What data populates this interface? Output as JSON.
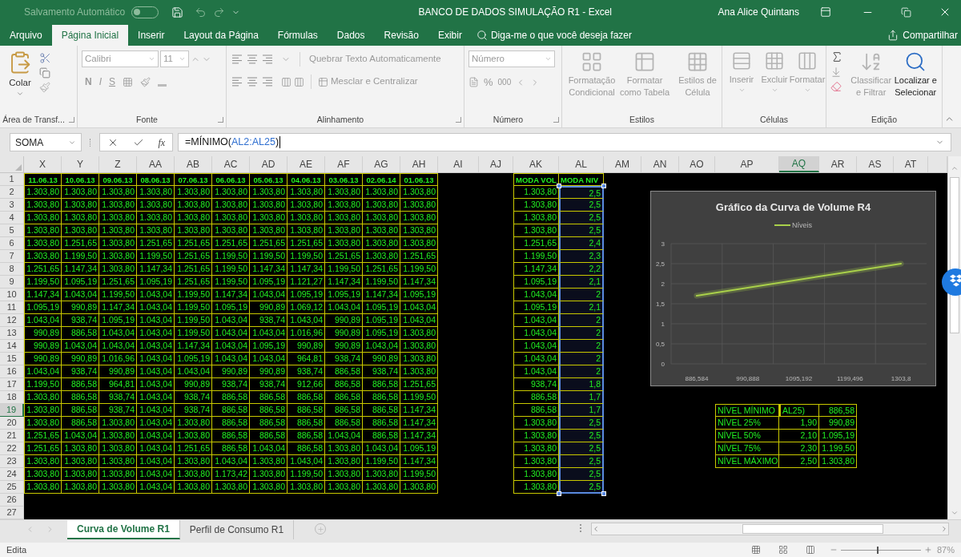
{
  "title_bar": {
    "autosave_label": "Salvamento Automático",
    "autosave_on": false,
    "document_title": "BANCO DE DADOS SIMULAÇÃO R1  -  Excel",
    "user": "Ana Alice Quintans"
  },
  "menu_tabs": [
    {
      "label": "Arquivo",
      "selected": false
    },
    {
      "label": "Página Inicial",
      "selected": true
    },
    {
      "label": "Inserir",
      "selected": false
    },
    {
      "label": "Layout da Página",
      "selected": false
    },
    {
      "label": "Fórmulas",
      "selected": false
    },
    {
      "label": "Dados",
      "selected": false
    },
    {
      "label": "Revisão",
      "selected": false
    },
    {
      "label": "Exibir",
      "selected": false
    }
  ],
  "tell_me": {
    "placeholder": "Diga-me o que você deseja fazer"
  },
  "share": "Compartilhar",
  "ribbon": {
    "clipboard": {
      "paste": "Colar",
      "group": "Área de Transf..."
    },
    "font": {
      "family": "Calibri",
      "size": "11",
      "bold": "N",
      "italic": "I",
      "underline": "S",
      "group": "Fonte"
    },
    "alignment": {
      "wrap": "Quebrar Texto Automaticamente",
      "merge": "Mesclar e Centralizar",
      "group": "Alinhamento"
    },
    "number": {
      "format": "Número",
      "percent": "%",
      "thousands": "000",
      "group": "Número"
    },
    "styles": {
      "items": [
        "Formatação Condicional",
        "Formatar como Tabela",
        "Estilos de Célula"
      ],
      "group": "Estilos"
    },
    "cells": {
      "items": [
        "Inserir",
        "Excluir",
        "Formatar"
      ],
      "group": "Células"
    },
    "editing": {
      "items": [
        {
          "label": "Classificar e Filtrar",
          "disabled": true
        },
        {
          "label": "Localizar e Selecionar",
          "disabled": false
        }
      ],
      "group": "Edição"
    }
  },
  "formula_bar": {
    "name_box": "SOMA",
    "function_label": "fx",
    "formula": [
      {
        "text": "=MÍNIMO(",
        "kind": "plain"
      },
      {
        "text": "AL2:AL25",
        "kind": "reference"
      },
      {
        "text": ")",
        "kind": "plain"
      }
    ]
  },
  "grid": {
    "columns": [
      {
        "label": "X",
        "selected": false
      },
      {
        "label": "Y",
        "selected": false
      },
      {
        "label": "Z",
        "selected": false
      },
      {
        "label": "AA",
        "selected": false
      },
      {
        "label": "AB",
        "selected": false
      },
      {
        "label": "AC",
        "selected": false
      },
      {
        "label": "AD",
        "selected": false
      },
      {
        "label": "AE",
        "selected": false
      },
      {
        "label": "AF",
        "selected": false
      },
      {
        "label": "AG",
        "selected": false
      },
      {
        "label": "AH",
        "selected": false
      },
      {
        "label": "AI",
        "selected": false
      },
      {
        "label": "AJ",
        "selected": false
      },
      {
        "label": "AK",
        "selected": false
      },
      {
        "label": "AL",
        "selected": false
      },
      {
        "label": "AM",
        "selected": false
      },
      {
        "label": "AN",
        "selected": false
      },
      {
        "label": "AO",
        "selected": false
      },
      {
        "label": "AP",
        "selected": false
      },
      {
        "label": "AQ",
        "selected": true
      },
      {
        "label": "AR",
        "selected": false
      },
      {
        "label": "AS",
        "selected": false
      },
      {
        "label": "AT",
        "selected": false
      }
    ],
    "rows": [
      {
        "number": "1",
        "selected": false,
        "header": true,
        "in_reference": false,
        "cells": [
          "11.06.13",
          "10.06.13",
          "09.06.13",
          "08.06.13",
          "07.06.13",
          "06.06.13",
          "05.06.13",
          "04.06.13",
          "03.06.13",
          "02.06.14",
          "01.06.13"
        ],
        "ak": "MODA VOL",
        "al": "MODA NIV"
      },
      {
        "number": "2",
        "selected": false,
        "header": false,
        "in_reference": true,
        "cells": [
          "1.303,80",
          "1.303,80",
          "1.303,80",
          "1.303,80",
          "1.303,80",
          "1.303,80",
          "1.303,80",
          "1.303,80",
          "1.303,80",
          "1.303,80",
          "1.303,80"
        ],
        "ak": "1.303,80",
        "al": "2,5"
      },
      {
        "number": "3",
        "selected": false,
        "header": false,
        "in_reference": true,
        "cells": [
          "1.303,80",
          "1.303,80",
          "1.303,80",
          "1.303,80",
          "1.303,80",
          "1.303,80",
          "1.303,80",
          "1.303,80",
          "1.303,80",
          "1.303,80",
          "1.303,80"
        ],
        "ak": "1.303,80",
        "al": "2,5"
      },
      {
        "number": "4",
        "selected": false,
        "header": false,
        "in_reference": true,
        "cells": [
          "1.303,80",
          "1.303,80",
          "1.303,80",
          "1.303,80",
          "1.303,80",
          "1.303,80",
          "1.303,80",
          "1.303,80",
          "1.303,80",
          "1.303,80",
          "1.303,80"
        ],
        "ak": "1.303,80",
        "al": "2,5"
      },
      {
        "number": "5",
        "selected": false,
        "header": false,
        "in_reference": true,
        "cells": [
          "1.303,80",
          "1.303,80",
          "1.303,80",
          "1.303,80",
          "1.303,80",
          "1.303,80",
          "1.303,80",
          "1.303,80",
          "1.303,80",
          "1.303,80",
          "1.303,80"
        ],
        "ak": "1.303,80",
        "al": "2,5"
      },
      {
        "number": "6",
        "selected": false,
        "header": false,
        "in_reference": true,
        "cells": [
          "1.303,80",
          "1.251,65",
          "1.303,80",
          "1.251,65",
          "1.251,65",
          "1.251,65",
          "1.251,65",
          "1.251,65",
          "1.303,80",
          "1.303,80",
          "1.303,80"
        ],
        "ak": "1.251,65",
        "al": "2,4"
      },
      {
        "number": "7",
        "selected": false,
        "header": false,
        "in_reference": true,
        "cells": [
          "1.303,80",
          "1.199,50",
          "1.303,80",
          "1.199,50",
          "1.251,65",
          "1.199,50",
          "1.199,50",
          "1.199,50",
          "1.251,65",
          "1.303,80",
          "1.251,65"
        ],
        "ak": "1.199,50",
        "al": "2,3"
      },
      {
        "number": "8",
        "selected": false,
        "header": false,
        "in_reference": true,
        "cells": [
          "1.251,65",
          "1.147,34",
          "1.303,80",
          "1.147,34",
          "1.251,65",
          "1.199,50",
          "1.147,34",
          "1.147,34",
          "1.199,50",
          "1.251,65",
          "1.199,50"
        ],
        "ak": "1.147,34",
        "al": "2,2"
      },
      {
        "number": "9",
        "selected": false,
        "header": false,
        "in_reference": true,
        "cells": [
          "1.199,50",
          "1.095,19",
          "1.251,65",
          "1.095,19",
          "1.251,65",
          "1.199,50",
          "1.095,19",
          "1.121,27",
          "1.147,34",
          "1.199,50",
          "1.147,34"
        ],
        "ak": "1.095,19",
        "al": "2,1"
      },
      {
        "number": "10",
        "selected": false,
        "header": false,
        "in_reference": true,
        "cells": [
          "1.147,34",
          "1.043,04",
          "1.199,50",
          "1.043,04",
          "1.199,50",
          "1.147,34",
          "1.043,04",
          "1.095,19",
          "1.095,19",
          "1.147,34",
          "1.095,19"
        ],
        "ak": "1.043,04",
        "al": "2"
      },
      {
        "number": "11",
        "selected": false,
        "header": false,
        "in_reference": true,
        "cells": [
          "1.095,19",
          "990,89",
          "1.147,34",
          "1.043,04",
          "1.199,50",
          "1.095,19",
          "990,89",
          "1.069,12",
          "1.043,04",
          "1.095,19",
          "1.043,04"
        ],
        "ak": "1.095,19",
        "al": "2,1"
      },
      {
        "number": "12",
        "selected": false,
        "header": false,
        "in_reference": true,
        "cells": [
          "1.043,04",
          "938,74",
          "1.095,19",
          "1.043,04",
          "1.199,50",
          "1.043,04",
          "938,74",
          "1.043,04",
          "990,89",
          "1.095,19",
          "1.043,04"
        ],
        "ak": "1.043,04",
        "al": "2"
      },
      {
        "number": "13",
        "selected": false,
        "header": false,
        "in_reference": true,
        "cells": [
          "990,89",
          "886,58",
          "1.043,04",
          "1.043,04",
          "1.199,50",
          "1.043,04",
          "1.043,04",
          "1.016,96",
          "990,89",
          "1.095,19",
          "1.303,80"
        ],
        "ak": "1.043,04",
        "al": "2"
      },
      {
        "number": "14",
        "selected": false,
        "header": false,
        "in_reference": true,
        "cells": [
          "990,89",
          "1.043,04",
          "1.043,04",
          "1.043,04",
          "1.147,34",
          "1.043,04",
          "1.095,19",
          "990,89",
          "990,89",
          "1.043,04",
          "1.303,80"
        ],
        "ak": "1.043,04",
        "al": "2"
      },
      {
        "number": "15",
        "selected": false,
        "header": false,
        "in_reference": true,
        "cells": [
          "990,89",
          "990,89",
          "1.016,96",
          "1.043,04",
          "1.095,19",
          "1.043,04",
          "1.043,04",
          "964,81",
          "938,74",
          "990,89",
          "1.303,80"
        ],
        "ak": "1.043,04",
        "al": "2"
      },
      {
        "number": "16",
        "selected": false,
        "header": false,
        "in_reference": true,
        "cells": [
          "1.043,04",
          "938,74",
          "990,89",
          "1.043,04",
          "1.043,04",
          "990,89",
          "990,89",
          "938,74",
          "886,58",
          "938,74",
          "1.303,80"
        ],
        "ak": "1.043,04",
        "al": "2"
      },
      {
        "number": "17",
        "selected": false,
        "header": false,
        "in_reference": true,
        "cells": [
          "1.199,50",
          "886,58",
          "964,81",
          "1.043,04",
          "990,89",
          "938,74",
          "938,74",
          "912,66",
          "886,58",
          "886,58",
          "1.251,65"
        ],
        "ak": "938,74",
        "al": "1,8"
      },
      {
        "number": "18",
        "selected": false,
        "header": false,
        "in_reference": true,
        "cells": [
          "1.303,80",
          "886,58",
          "938,74",
          "1.043,04",
          "938,74",
          "886,58",
          "886,58",
          "886,58",
          "886,58",
          "886,58",
          "1.199,50"
        ],
        "ak": "886,58",
        "al": "1,7"
      },
      {
        "number": "19",
        "selected": true,
        "header": false,
        "in_reference": true,
        "cells": [
          "1.303,80",
          "886,58",
          "938,74",
          "1.043,04",
          "938,74",
          "886,58",
          "886,58",
          "886,58",
          "886,58",
          "886,58",
          "1.147,34"
        ],
        "ak": "886,58",
        "al": "1,7",
        "summary": {
          "label": "NÍVEL MÍNIMO",
          "value": "AL25)",
          "result": "886,58",
          "editing": true
        }
      },
      {
        "number": "20",
        "selected": false,
        "header": false,
        "in_reference": true,
        "cells": [
          "1.303,80",
          "886,58",
          "1.303,80",
          "1.043,04",
          "1.303,80",
          "886,58",
          "886,58",
          "886,58",
          "886,58",
          "886,58",
          "1.147,34"
        ],
        "ak": "1.303,80",
        "al": "2,5",
        "summary": {
          "label": "NÍVEL 25%",
          "value": "1,90",
          "result": "990,89",
          "editing": false
        }
      },
      {
        "number": "21",
        "selected": false,
        "header": false,
        "in_reference": true,
        "cells": [
          "1.251,65",
          "1.043,04",
          "1.303,80",
          "1.043,04",
          "1.303,80",
          "886,58",
          "886,58",
          "886,58",
          "1.043,04",
          "886,58",
          "1.147,34"
        ],
        "ak": "1.303,80",
        "al": "2,5",
        "summary": {
          "label": "NÍVEL 50%",
          "value": "2,10",
          "result": "1.095,19",
          "editing": false
        }
      },
      {
        "number": "22",
        "selected": false,
        "header": false,
        "in_reference": true,
        "cells": [
          "1.251,65",
          "1.303,80",
          "1.303,80",
          "1.043,04",
          "1.251,65",
          "886,58",
          "1.043,04",
          "886,58",
          "1.303,80",
          "1.043,04",
          "1.095,19"
        ],
        "ak": "1.303,80",
        "al": "2,5",
        "summary": {
          "label": "NÍVEL 75%",
          "value": "2,30",
          "result": "1.199,50",
          "editing": false
        }
      },
      {
        "number": "23",
        "selected": false,
        "header": false,
        "in_reference": true,
        "cells": [
          "1.303,80",
          "1.303,80",
          "1.303,80",
          "1.043,04",
          "1.303,80",
          "1.043,04",
          "1.303,80",
          "1.043,04",
          "1.303,80",
          "1.199,50",
          "1.147,34"
        ],
        "ak": "1.303,80",
        "al": "2,5",
        "summary": {
          "label": "NÍVEL MÁXIMO",
          "value": "2,50",
          "result": "1.303,80",
          "editing": false
        }
      },
      {
        "number": "24",
        "selected": false,
        "header": false,
        "in_reference": true,
        "cells": [
          "1.303,80",
          "1.303,80",
          "1.303,80",
          "1.043,04",
          "1.303,80",
          "1.173,42",
          "1.303,80",
          "1.199,50",
          "1.303,80",
          "1.303,80",
          "1.199,50"
        ],
        "ak": "1.303,80",
        "al": "2,5"
      },
      {
        "number": "25",
        "selected": false,
        "header": false,
        "in_reference": true,
        "cells": [
          "1.303,80",
          "1.303,80",
          "1.303,80",
          "1.043,04",
          "1.303,80",
          "1.303,80",
          "1.303,80",
          "1.303,80",
          "1.303,80",
          "1.303,80",
          "1.303,80"
        ],
        "ak": "1.303,80",
        "al": "2,5"
      },
      {
        "number": "26",
        "selected": false
      },
      {
        "number": "27",
        "selected": false
      }
    ],
    "chart": {
      "chart_data": {
        "type": "line",
        "grid": true,
        "title": "Gráfico da Curva de Volume R4",
        "categories": [
          "886,584",
          "990,888",
          "1095,192",
          "1199,496",
          "1303,8"
        ],
        "series": [
          {
            "name": "Níveis",
            "color": "#a9d04a",
            "values": [
              1.7,
              1.9,
              2.1,
              2.3,
              2.5
            ]
          }
        ],
        "ylim": [
          0,
          3
        ],
        "yticks": [
          0,
          {
            "value": 0.5,
            "label": "0,5"
          },
          1,
          {
            "value": 1.5,
            "label": "1,5"
          },
          2,
          {
            "value": 2.5,
            "label": "2,5"
          },
          3
        ]
      }
    }
  },
  "sheet_tabs": [
    {
      "label": "Curva de Volume R1",
      "selected": true
    },
    {
      "label": "Perfil de Consumo R1",
      "selected": false
    }
  ],
  "status_bar": {
    "mode": "Edita",
    "zoom": "87%",
    "zoom_slider": {
      "level": 0.45
    }
  }
}
